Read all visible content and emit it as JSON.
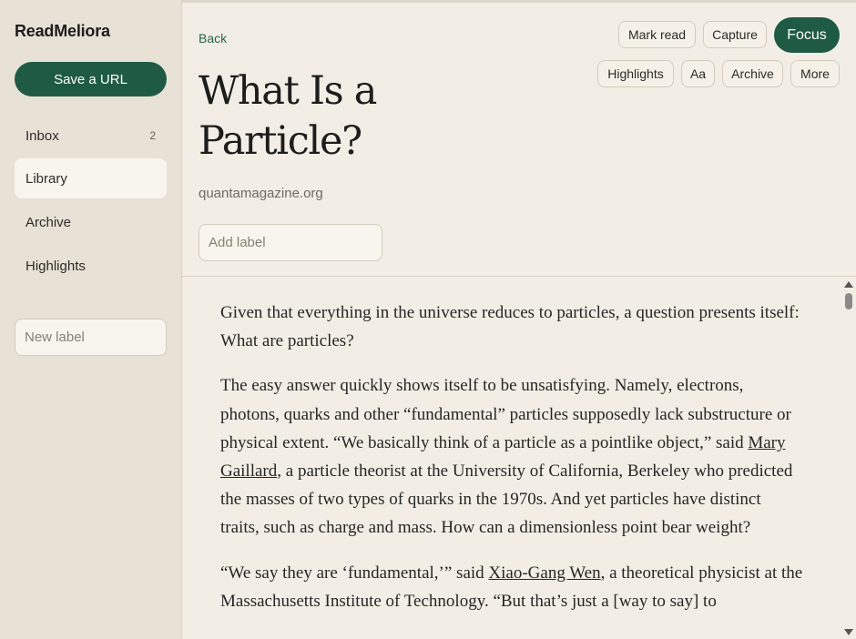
{
  "app": {
    "name": "ReadMeliora"
  },
  "sidebar": {
    "save_url_label": "Save a URL",
    "items": [
      {
        "label": "Inbox",
        "count": "2"
      },
      {
        "label": "Library",
        "count": ""
      },
      {
        "label": "Archive",
        "count": ""
      },
      {
        "label": "Highlights",
        "count": ""
      }
    ],
    "active_item": "Library",
    "new_label_placeholder": "New label"
  },
  "header": {
    "back_label": "Back",
    "title": "What Is a Particle?",
    "source": "quantamagazine.org",
    "add_label_placeholder": "Add label",
    "toolbar": {
      "mark_read": "Mark read",
      "capture": "Capture",
      "focus": "Focus",
      "highlights": "Highlights",
      "font_size": "Aa",
      "archive": "Archive",
      "more": "More"
    }
  },
  "article": {
    "p1": "Given that everything in the universe reduces to particles, a question presents itself: What are particles?",
    "p2": {
      "before": "The easy answer quickly shows itself to be unsatisfying. Namely, electrons, photons, quarks and other “fundamental” particles supposedly lack substructure or physical extent. “We basically think of a particle as a pointlike object,” said ",
      "link": "Mary Gaillard",
      "after": ", a particle theorist at the University of California, Berkeley who predicted the masses of two types of quarks in the 1970s. And yet particles have distinct traits, such as charge and mass. How can a dimensionless point bear weight?"
    },
    "p3": {
      "before": "“We say they are ‘fundamental,’” said ",
      "link": "Xiao-Gang Wen",
      "after": ", a theoretical physicist at the Massachusetts Institute of Technology. “But that’s just a [way to say] to"
    }
  }
}
